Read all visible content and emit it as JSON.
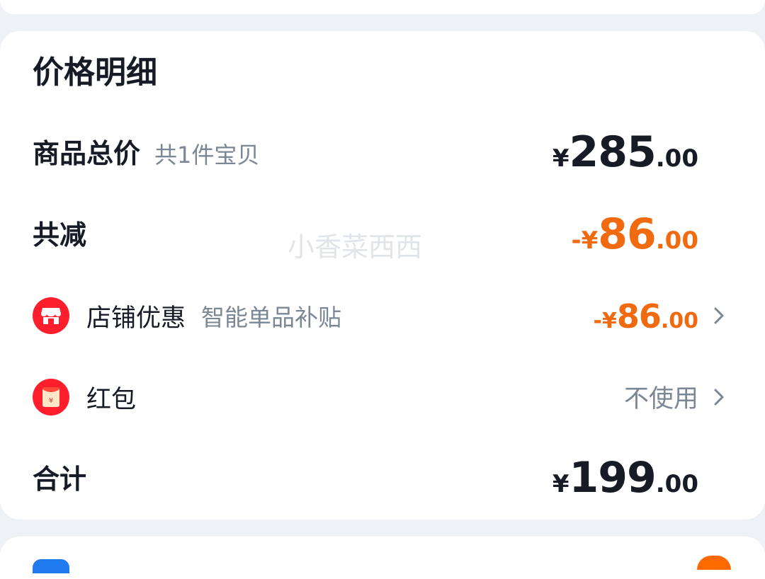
{
  "colors": {
    "page_background": "#eef2f6",
    "card_background": "#ffffff",
    "primary_text": "#161b26",
    "secondary_text": "#7c8796",
    "discount_orange": "#f26a10",
    "icon_red": "#ff1f2c"
  },
  "title": "价格明细",
  "goods_total": {
    "label": "商品总价",
    "note": "共1件宝贝",
    "currency": "¥",
    "integer": "285",
    "decimal": ".00"
  },
  "total_discount": {
    "label": "共减",
    "sign": "-",
    "currency": "¥",
    "integer": "86",
    "decimal": ".00"
  },
  "store_discount": {
    "icon": "store-icon",
    "label": "店铺优惠",
    "note": "智能单品补贴",
    "sign": "-",
    "currency": "¥",
    "integer": "86",
    "decimal": ".00"
  },
  "red_packet": {
    "icon": "red-envelope-icon",
    "label": "红包",
    "value": "不使用"
  },
  "sum": {
    "label": "合计",
    "currency": "¥",
    "integer": "199",
    "decimal": ".00"
  },
  "watermark": "小香菜西西"
}
